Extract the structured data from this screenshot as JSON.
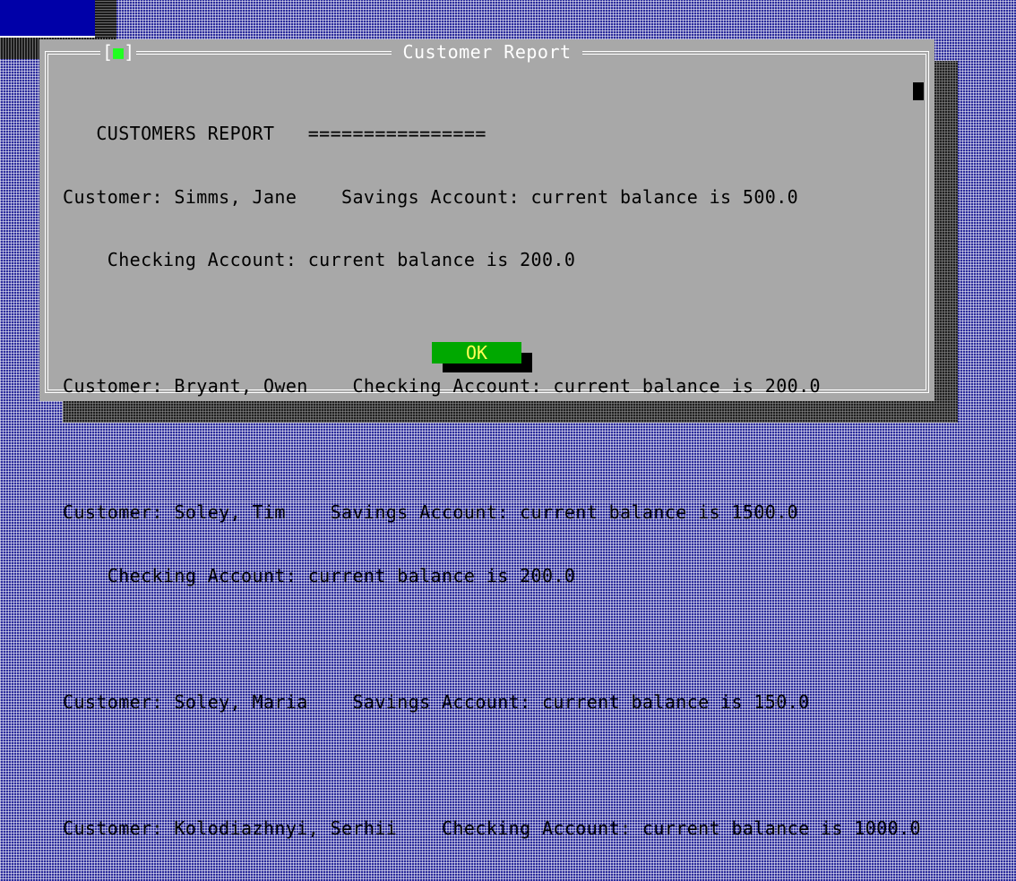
{
  "dialog": {
    "title": "Customer Report",
    "close_left": "[",
    "close_glyph": "■",
    "close_right": "]",
    "ok_label": "OK"
  },
  "report": {
    "lines": [
      "   CUSTOMERS REPORT   ================",
      "Customer: Simms, Jane    Savings Account: current balance is 500.0",
      "    Checking Account: current balance is 200.0",
      "",
      "Customer: Bryant, Owen    Checking Account: current balance is 200.0",
      "",
      "Customer: Soley, Tim    Savings Account: current balance is 1500.0",
      "    Checking Account: current balance is 200.0",
      "",
      "Customer: Soley, Maria    Savings Account: current balance is 150.0",
      "",
      "Customer: Kolodiazhnyi, Serhii    Checking Account: current balance is 1000.0"
    ]
  },
  "colors": {
    "desktop": "#2d2d9c",
    "dialog_bg": "#a8a8a8",
    "frame": "#ffffff",
    "ok_button_bg": "#00a800",
    "ok_button_text": "#ffff55",
    "close_glyph": "#20ff20"
  }
}
